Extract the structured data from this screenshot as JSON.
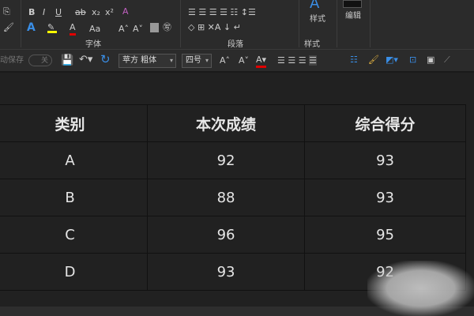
{
  "ribbon": {
    "groups": {
      "font": "字体",
      "paragraph": "段落",
      "styles": "样式"
    },
    "buttons": {
      "styles": "样式",
      "edit": "编辑",
      "bold": "B",
      "italic": "I",
      "underline": "U",
      "strike": "ab",
      "subscript": "x₂",
      "superscript": "x²",
      "font_color": "A",
      "change_case": "Aa",
      "grow": "A˄",
      "shrink": "A˅"
    }
  },
  "quickbar": {
    "autosave": "动保存",
    "autosave_state": "关",
    "font_name": "苹方 粗体",
    "font_size": "四号"
  },
  "table": {
    "headers": [
      "类别",
      "本次成绩",
      "综合得分"
    ],
    "rows": [
      [
        "A",
        "92",
        "93"
      ],
      [
        "B",
        "88",
        "93"
      ],
      [
        "C",
        "96",
        "95"
      ],
      [
        "D",
        "93",
        "92"
      ]
    ]
  },
  "colors": {
    "highlight": "#ffff00",
    "font_red": "#e00000",
    "accent": "#3a8ee6",
    "save": "#b040c0"
  }
}
